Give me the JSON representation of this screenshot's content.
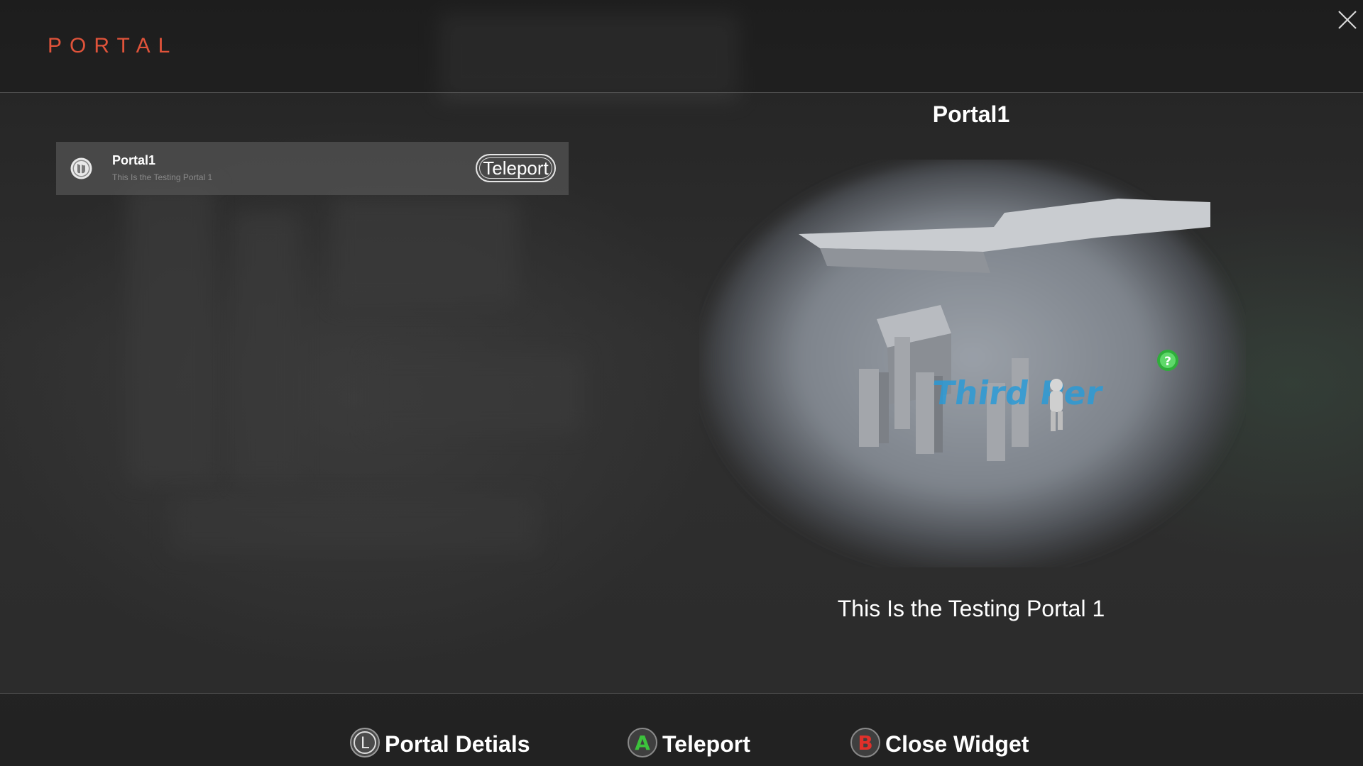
{
  "header": {
    "title": "PORTAL",
    "close_icon": "close-icon"
  },
  "portal_list": [
    {
      "name": "Portal1",
      "description": "This Is the Testing Portal 1",
      "button_label": "Teleport",
      "icon": "unreal-logo-icon"
    }
  ],
  "detail": {
    "title": "Portal1",
    "description": "This Is the Testing Portal 1",
    "preview_icon": "portal-preview-image"
  },
  "footer": {
    "hints": [
      {
        "button": "L",
        "label": "Portal Detials",
        "color": "#c8c8c8"
      },
      {
        "button": "A",
        "label": "Teleport",
        "color": "#3cc23c"
      },
      {
        "button": "B",
        "label": "Close Widget",
        "color": "#e0302a"
      }
    ]
  },
  "colors": {
    "accent": "#e0533a"
  }
}
